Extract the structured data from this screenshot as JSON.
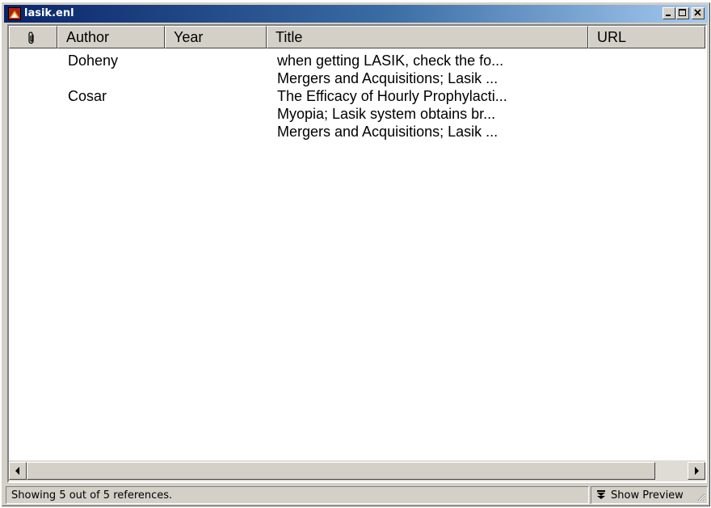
{
  "window": {
    "title": "lasik.enl",
    "title_icon": "endnote-library-icon",
    "controls": [
      "minimize-icon",
      "maximize-icon",
      "close-icon"
    ]
  },
  "columns": {
    "attachment_icon": "paperclip-icon",
    "author": "Author",
    "year": "Year",
    "title": "Title",
    "url": "URL"
  },
  "rows": [
    {
      "author": "Doheny",
      "year": "",
      "title": "when getting LASIK, check the fo...",
      "url": ""
    },
    {
      "author": "",
      "year": "",
      "title": "Mergers and Acquisitions; Lasik ...",
      "url": ""
    },
    {
      "author": "Cosar",
      "year": "",
      "title": "The Efficacy of Hourly Prophylacti...",
      "url": ""
    },
    {
      "author": "",
      "year": "",
      "title": "Myopia; Lasik system obtains br...",
      "url": ""
    },
    {
      "author": "",
      "year": "",
      "title": "Mergers and Acquisitions; Lasik ...",
      "url": ""
    }
  ],
  "status": {
    "text": "Showing 5 out of 5 references.",
    "preview_label": "Show Preview",
    "preview_icon": "double-chevron-down-icon"
  }
}
